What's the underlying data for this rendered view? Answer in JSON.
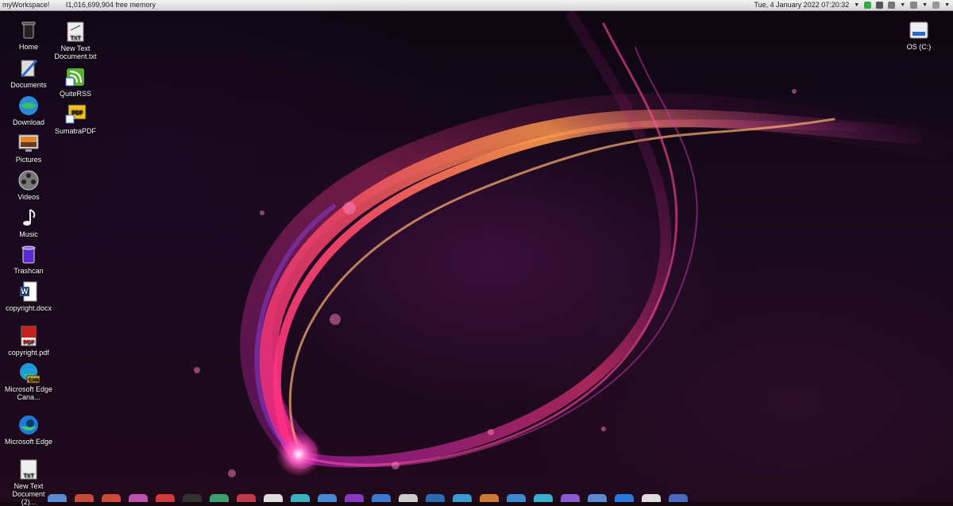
{
  "topbar": {
    "workspace": "myWorkspace!",
    "memory": "I1,016,699,904 free memory",
    "clock": "Tue, 4 January 2022 07:20:32"
  },
  "desktop_left": [
    {
      "label": "Home",
      "icon": "trashcan-black-icon"
    },
    {
      "label": "Documents",
      "icon": "documents-pen-icon"
    },
    {
      "label": "Download",
      "icon": "globe-download-icon"
    },
    {
      "label": "Pictures",
      "icon": "monitor-picture-icon"
    },
    {
      "label": "Videos",
      "icon": "film-reel-icon"
    },
    {
      "label": "Music",
      "icon": "music-note-icon"
    },
    {
      "label": "Trashcan",
      "icon": "trashcan-icon"
    },
    {
      "label": "copyright.docx",
      "icon": "word-document-icon"
    },
    {
      "label": "copyright.pdf",
      "icon": "pdf-document-icon"
    },
    {
      "label": "Microsoft Edge Cana...",
      "icon": "edge-canary-icon"
    },
    {
      "label": "Microsoft Edge",
      "icon": "edge-icon"
    },
    {
      "label": "New Text Document (2)...",
      "icon": "txt-file-icon"
    }
  ],
  "desktop_col2": [
    {
      "label": "New Text Document.txt",
      "icon": "txt-file-icon"
    },
    {
      "label": "QuiteRSS",
      "icon": "rss-icon"
    },
    {
      "label": "SumatraPDF",
      "icon": "sumatrapdf-icon"
    }
  ],
  "desktop_right": [
    {
      "label": "OS (C:)",
      "icon": "drive-icon"
    }
  ],
  "icon_badges": {
    "txt": "TXT",
    "pdf": "PDF",
    "can": "CAN",
    "pdf2": "PDF"
  }
}
